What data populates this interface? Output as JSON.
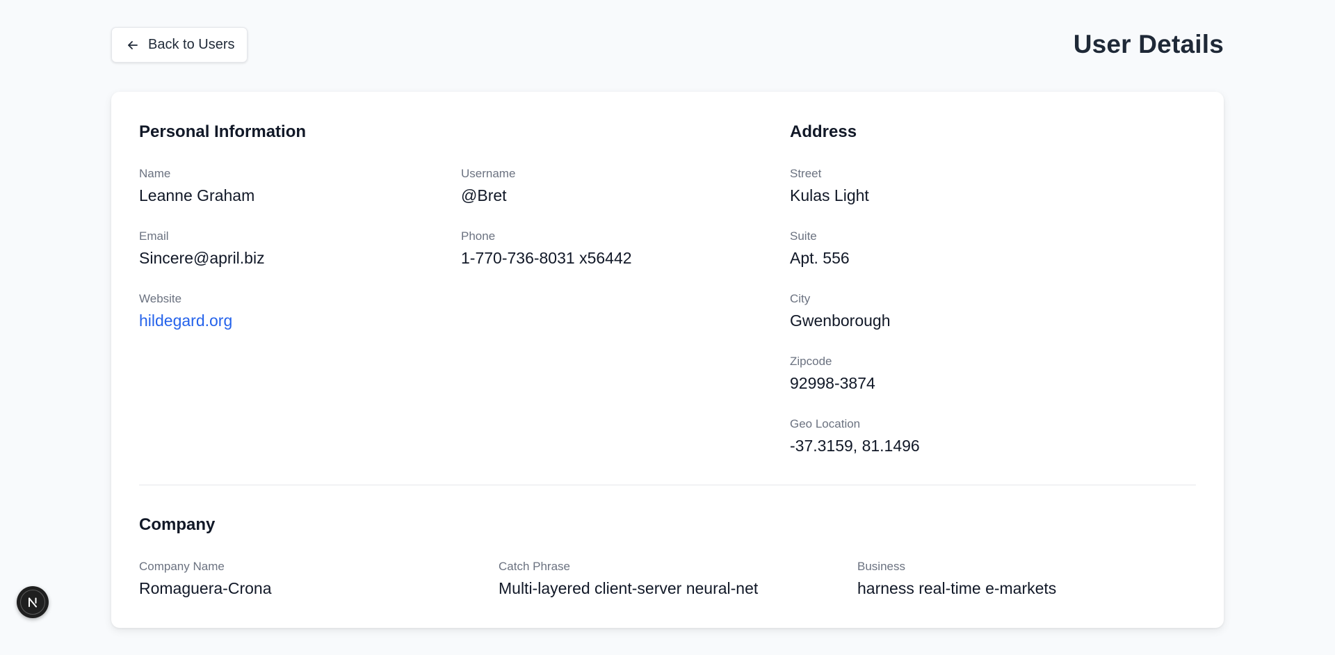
{
  "header": {
    "back_label": "Back to Users",
    "title": "User Details"
  },
  "personal": {
    "title": "Personal Information",
    "name_label": "Name",
    "name": "Leanne Graham",
    "username_label": "Username",
    "username": "@Bret",
    "email_label": "Email",
    "email": "Sincere@april.biz",
    "phone_label": "Phone",
    "phone": "1-770-736-8031 x56442",
    "website_label": "Website",
    "website": "hildegard.org"
  },
  "address": {
    "title": "Address",
    "street_label": "Street",
    "street": "Kulas Light",
    "suite_label": "Suite",
    "suite": "Apt. 556",
    "city_label": "City",
    "city": "Gwenborough",
    "zipcode_label": "Zipcode",
    "zipcode": "92998-3874",
    "geo_label": "Geo Location",
    "geo": "-37.3159, 81.1496"
  },
  "company": {
    "title": "Company",
    "name_label": "Company Name",
    "name": "Romaguera-Crona",
    "catch_label": "Catch Phrase",
    "catch": "Multi-layered client-server neural-net",
    "bs_label": "Business",
    "bs": "harness real-time e-markets"
  },
  "icons": {
    "back": "arrow-left-icon",
    "fab": "nextjs-logo-icon"
  },
  "colors": {
    "link": "#2563eb",
    "background": "#f8fafc",
    "card": "#ffffff"
  }
}
